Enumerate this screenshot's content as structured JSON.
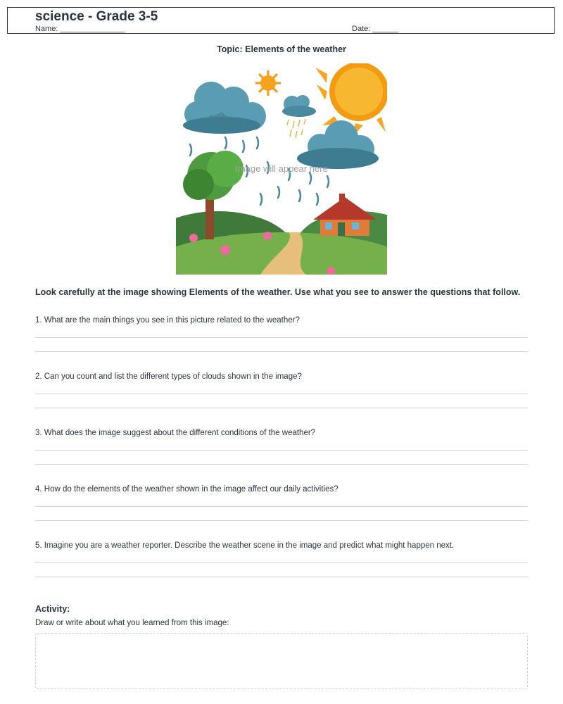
{
  "header": {
    "title": "science - Grade 3-5",
    "name_label": "Name: _______________",
    "date_label": "Date: ______"
  },
  "topic": "Topic: Elements of the weather",
  "illustration": {
    "placeholder": "Image will appear here"
  },
  "instructions": "Look carefully at the image showing Elements of the weather. Use what you see to answer the questions that follow.",
  "questions": [
    {
      "text": "1. What are the main things you see in this picture related to the weather?"
    },
    {
      "text": "2. Can you count and list the different types of clouds shown in the image?"
    },
    {
      "text": "3. What does the image suggest about the different conditions of the weather?"
    },
    {
      "text": "4. How do the elements of the weather shown in the image affect our daily activities?"
    },
    {
      "text": "5. Imagine you are a weather reporter. Describe the weather scene in the image and predict what might happen next."
    }
  ],
  "activity": {
    "title": "Activity:",
    "subtitle": "Draw or write about what you learned from this image:"
  },
  "colors": {
    "text": "#2b3340",
    "line": "#d0d4d9",
    "dashed_border": "#cfd3d8"
  }
}
